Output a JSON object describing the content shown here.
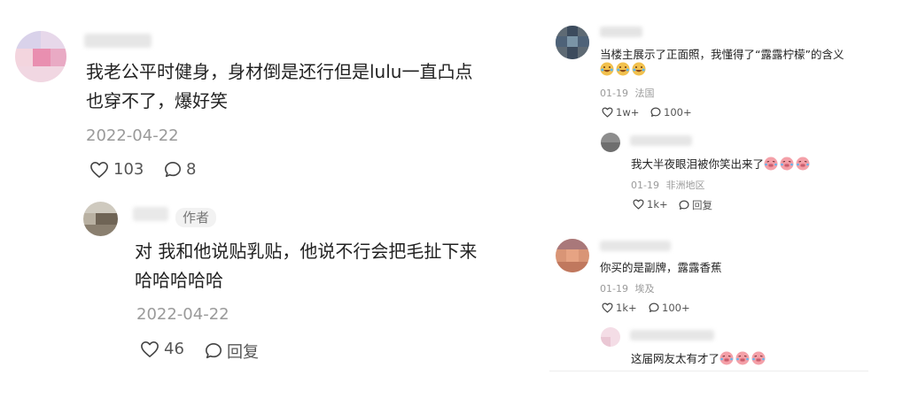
{
  "left_thread": {
    "comment": {
      "lines": [
        "我老公平时健身，身材倒是还行但是lulu一直凸点",
        "也穿不了，爆好笑"
      ],
      "date": "2022-04-22",
      "likes": "103",
      "replies": "8"
    },
    "reply": {
      "author_tag": "作者",
      "lines": [
        "对 我和他说贴乳贴，他说不行会把毛扯下来",
        "哈哈哈哈哈"
      ],
      "date": "2022-04-22",
      "likes": "46",
      "reply_label": "回复"
    }
  },
  "right_thread": {
    "comments": [
      {
        "text": "当楼主展示了正面照，我懂得了“露露柠檬”的含义",
        "emoji": [
          "laugh-cry-emoji",
          "laugh-cry-emoji",
          "laugh-cry-emoji"
        ],
        "date": "01-19",
        "location": "法国",
        "likes": "1w+",
        "replies": "100+"
      },
      {
        "text": "我大半夜眼泪被你笑出来了",
        "emoji": [
          "pig-laugh-emoji",
          "pig-laugh-emoji",
          "pig-laugh-emoji"
        ],
        "date": "01-19",
        "location": "非洲地区",
        "likes": "1k+",
        "reply_label": "回复"
      },
      {
        "text": "你买的是副牌，露露香蕉",
        "date": "01-19",
        "location": "埃及",
        "likes": "1k+",
        "replies": "100+"
      },
      {
        "text": "这届网友太有才了",
        "emoji": [
          "pig-laugh-emoji",
          "pig-laugh-emoji",
          "pig-laugh-emoji"
        ]
      }
    ]
  },
  "colors": {
    "text": "#222222",
    "meta": "#9a9a9a",
    "action": "#555555",
    "emoji_laugh": "#f2c14e",
    "emoji_pig": "#f4a0a8"
  }
}
